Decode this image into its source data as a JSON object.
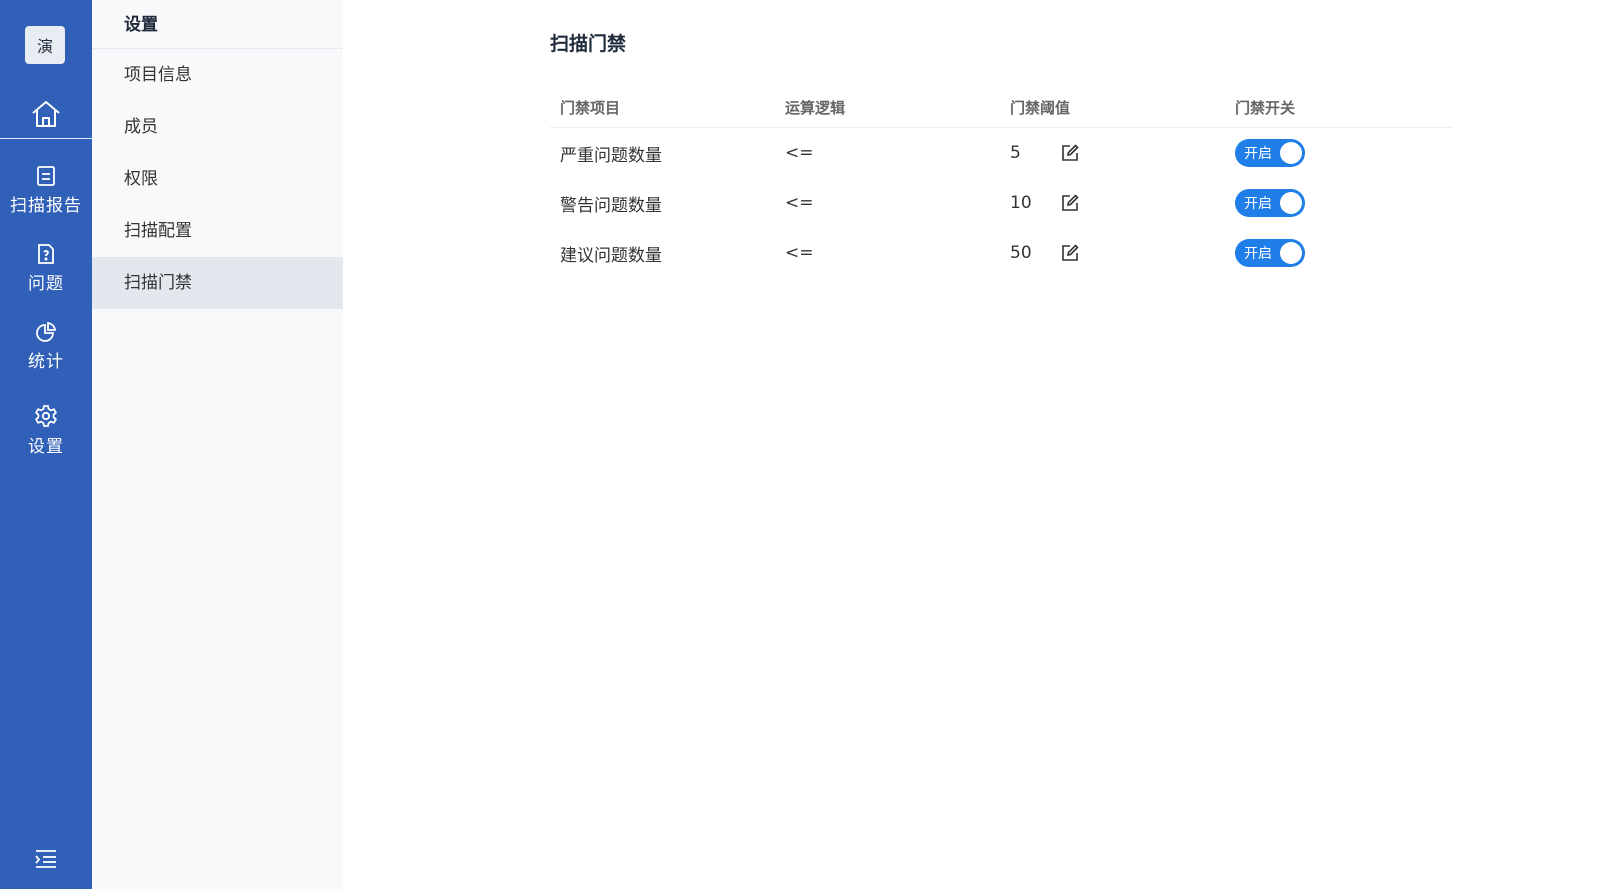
{
  "rail": {
    "avatar_text": "演",
    "items": [
      {
        "label": "扫描报告",
        "icon": "report-icon"
      },
      {
        "label": "问题",
        "icon": "issue-doc-icon"
      },
      {
        "label": "统计",
        "icon": "pie-chart-icon"
      },
      {
        "label": "设置",
        "icon": "gear-icon"
      }
    ]
  },
  "sidebar": {
    "title": "设置",
    "items": [
      {
        "label": "项目信息"
      },
      {
        "label": "成员"
      },
      {
        "label": "权限"
      },
      {
        "label": "扫描配置"
      },
      {
        "label": "扫描门禁",
        "active": true
      }
    ]
  },
  "main": {
    "title": "扫描门禁",
    "columns": [
      "门禁项目",
      "运算逻辑",
      "门禁阈值",
      "门禁开关"
    ],
    "rows": [
      {
        "item": "严重问题数量",
        "logic": "<=",
        "threshold": "5",
        "switch": "开启"
      },
      {
        "item": "警告问题数量",
        "logic": "<=",
        "threshold": "10",
        "switch": "开启"
      },
      {
        "item": "建议问题数量",
        "logic": "<=",
        "threshold": "50",
        "switch": "开启"
      }
    ]
  },
  "colors": {
    "rail": "#3060b8",
    "toggle_on": "#1f7ee8",
    "active_item": "#e3e7ee"
  }
}
